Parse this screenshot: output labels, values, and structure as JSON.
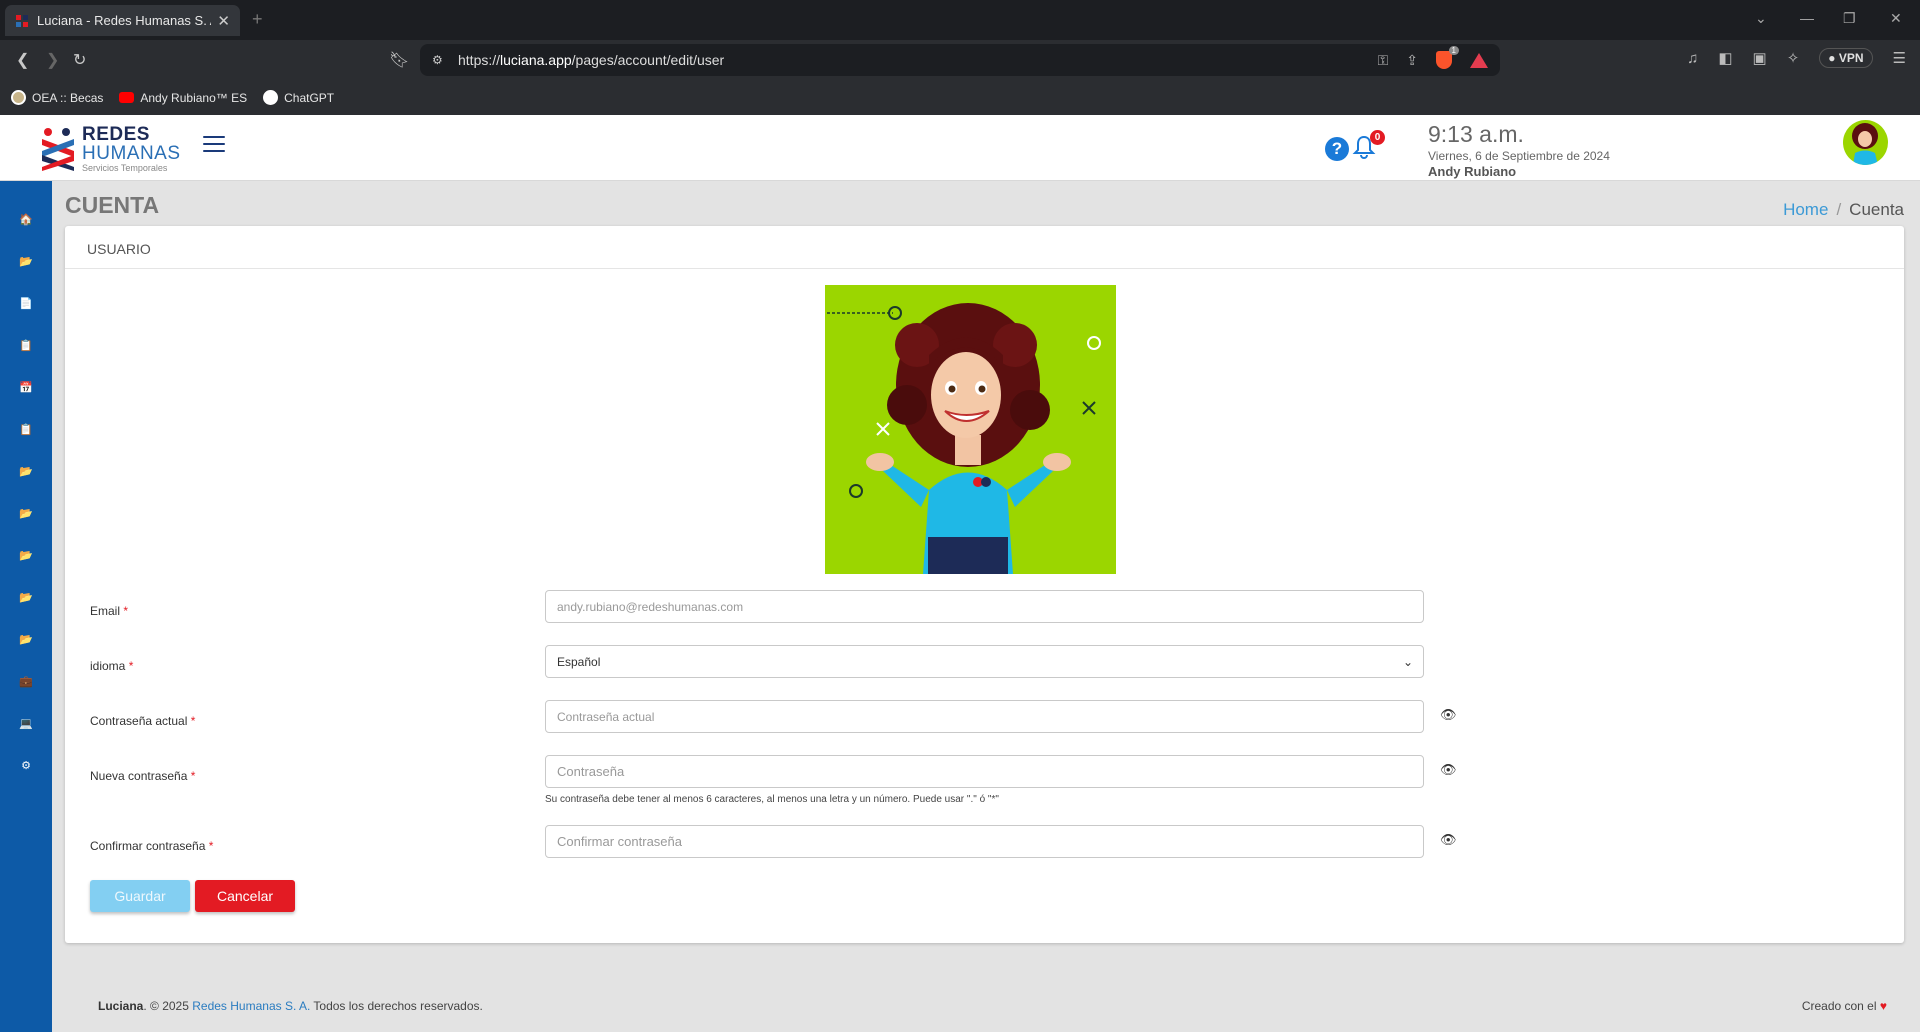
{
  "browser": {
    "tab_title": "Luciana - Redes Humanas S. A.",
    "url_prefix": "https://",
    "url_host": "luciana.app",
    "url_path": "/pages/account/edit/user",
    "shield_count": "1",
    "vpn_label": "VPN",
    "bookmarks": [
      {
        "label": "OEA :: Becas",
        "icon": "oea-icon"
      },
      {
        "label": "Andy Rubiano™ ES",
        "icon": "youtube-icon"
      },
      {
        "label": "ChatGPT",
        "icon": "chatgpt-icon"
      }
    ]
  },
  "header": {
    "logo_line1": "REDES",
    "logo_line2": "HUMANAS",
    "logo_tagline": "Servicios Temporales",
    "help_label": "?",
    "notification_count": "0",
    "time": "9:13 a.m.",
    "date": "Viernes, 6 de Septiembre de 2024",
    "user_name": "Andy Rubiano"
  },
  "sidebar": {
    "items": [
      {
        "icon": "home-icon",
        "glyph": "🏠"
      },
      {
        "icon": "folder-icon",
        "glyph": "📂"
      },
      {
        "icon": "document-icon",
        "glyph": "📄"
      },
      {
        "icon": "report-icon",
        "glyph": "📋"
      },
      {
        "icon": "calendar-icon",
        "glyph": "📅"
      },
      {
        "icon": "report-icon",
        "glyph": "📋"
      },
      {
        "icon": "folder-icon",
        "glyph": "📂"
      },
      {
        "icon": "folder-icon",
        "glyph": "📂"
      },
      {
        "icon": "folder-icon",
        "glyph": "📂"
      },
      {
        "icon": "folder-icon",
        "glyph": "📂"
      },
      {
        "icon": "folder-icon",
        "glyph": "📂"
      },
      {
        "icon": "briefcase-icon",
        "glyph": "💼"
      },
      {
        "icon": "laptop-icon",
        "glyph": "💻"
      },
      {
        "icon": "gear-icon",
        "glyph": "⚙"
      }
    ]
  },
  "page": {
    "title": "CUENTA",
    "breadcrumb_home": "Home",
    "breadcrumb_sep": "/",
    "breadcrumb_current": "Cuenta",
    "card_title": "USUARIO"
  },
  "form": {
    "required_mark": "*",
    "email_label": "Email",
    "email_value": "andy.rubiano@redeshumanas.com",
    "language_label": "idioma",
    "language_value": "Español",
    "current_password_label": "Contraseña actual",
    "current_password_placeholder": "Contraseña actual",
    "new_password_label": "Nueva contraseña",
    "new_password_placeholder": "Contraseña",
    "password_hint": "Su contraseña debe tener al menos 6 caracteres, al menos una letra y un número. Puede usar \".\" ó \"*\"",
    "confirm_password_label": "Confirmar contraseña",
    "confirm_password_placeholder": "Confirmar contraseña",
    "save_label": "Guardar",
    "cancel_label": "Cancelar"
  },
  "footer": {
    "app_name": "Luciana",
    "copyright": ". © 2025 ",
    "company": "Redes Humanas S. A.",
    "rights": " Todos los derechos reservados.",
    "created_with": "Creado con el"
  },
  "colors": {
    "sidebar": "#0d5aa7",
    "accent_blue": "#1a7ad8",
    "danger": "#e31b23",
    "save_button": "#83cff2",
    "avatar_bg": "#9bd600"
  }
}
